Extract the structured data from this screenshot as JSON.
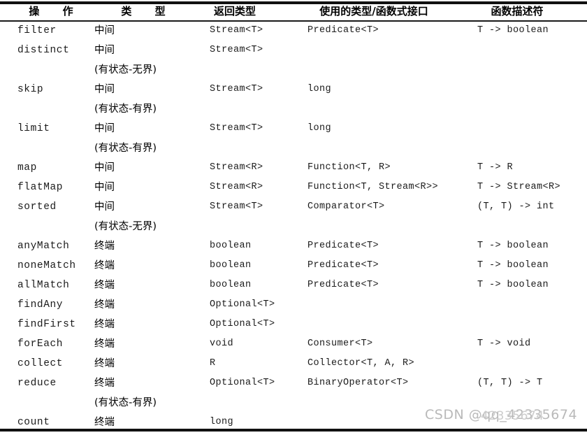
{
  "table": {
    "headers": {
      "operation": "操 作",
      "type": "类 型",
      "return_type": "返回类型",
      "interface": "使用的类型/函数式接口",
      "descriptor": "函数描述符"
    },
    "rows": [
      {
        "operation": "filter",
        "type": "中间",
        "state_note": "",
        "return_type": "Stream<T>",
        "interface": "Predicate<T>",
        "descriptor": "T -> boolean"
      },
      {
        "operation": "distinct",
        "type": "中间",
        "state_note": "(有状态-无界)",
        "return_type": "Stream<T>",
        "interface": "",
        "descriptor": ""
      },
      {
        "operation": "skip",
        "type": "中间",
        "state_note": "(有状态-有界)",
        "return_type": "Stream<T>",
        "interface": "long",
        "descriptor": ""
      },
      {
        "operation": "limit",
        "type": "中间",
        "state_note": "(有状态-有界)",
        "return_type": "Stream<T>",
        "interface": "long",
        "descriptor": ""
      },
      {
        "operation": "map",
        "type": "中间",
        "state_note": "",
        "return_type": "Stream<R>",
        "interface": "Function<T, R>",
        "descriptor": "T -> R"
      },
      {
        "operation": "flatMap",
        "type": "中间",
        "state_note": "",
        "return_type": "Stream<R>",
        "interface": "Function<T, Stream<R>>",
        "descriptor": "T -> Stream<R>"
      },
      {
        "operation": "sorted",
        "type": "中间",
        "state_note": "(有状态-无界)",
        "return_type": "Stream<T>",
        "interface": "Comparator<T>",
        "descriptor": "(T, T) -> int"
      },
      {
        "operation": "anyMatch",
        "type": "终端",
        "state_note": "",
        "return_type": "boolean",
        "interface": "Predicate<T>",
        "descriptor": "T -> boolean"
      },
      {
        "operation": "noneMatch",
        "type": "终端",
        "state_note": "",
        "return_type": "boolean",
        "interface": "Predicate<T>",
        "descriptor": "T -> boolean"
      },
      {
        "operation": "allMatch",
        "type": "终端",
        "state_note": "",
        "return_type": "boolean",
        "interface": "Predicate<T>",
        "descriptor": "T -> boolean"
      },
      {
        "operation": "findAny",
        "type": "终端",
        "state_note": "",
        "return_type": "Optional<T>",
        "interface": "",
        "descriptor": ""
      },
      {
        "operation": "findFirst",
        "type": "终端",
        "state_note": "",
        "return_type": "Optional<T>",
        "interface": "",
        "descriptor": ""
      },
      {
        "operation": "forEach",
        "type": "终端",
        "state_note": "",
        "return_type": "void",
        "interface": "Consumer<T>",
        "descriptor": "T -> void"
      },
      {
        "operation": "collect",
        "type": "终端",
        "state_note": "",
        "return_type": "R",
        "interface": "Collector<T, A, R>",
        "descriptor": ""
      },
      {
        "operation": "reduce",
        "type": "终端",
        "state_note": "(有状态-有界)",
        "return_type": "Optional<T>",
        "interface": "BinaryOperator<T>",
        "descriptor": "(T, T) -> T"
      },
      {
        "operation": "count",
        "type": "终端",
        "state_note": "",
        "return_type": "long",
        "interface": "",
        "descriptor": ""
      }
    ]
  },
  "watermark": {
    "text": "CSDN @qq_42335674",
    "overlay": "42335674"
  },
  "colors": {
    "rule": "#111111",
    "text": "#1b1b1b",
    "watermark": "#b9b9b9",
    "background": "#ffffff"
  }
}
